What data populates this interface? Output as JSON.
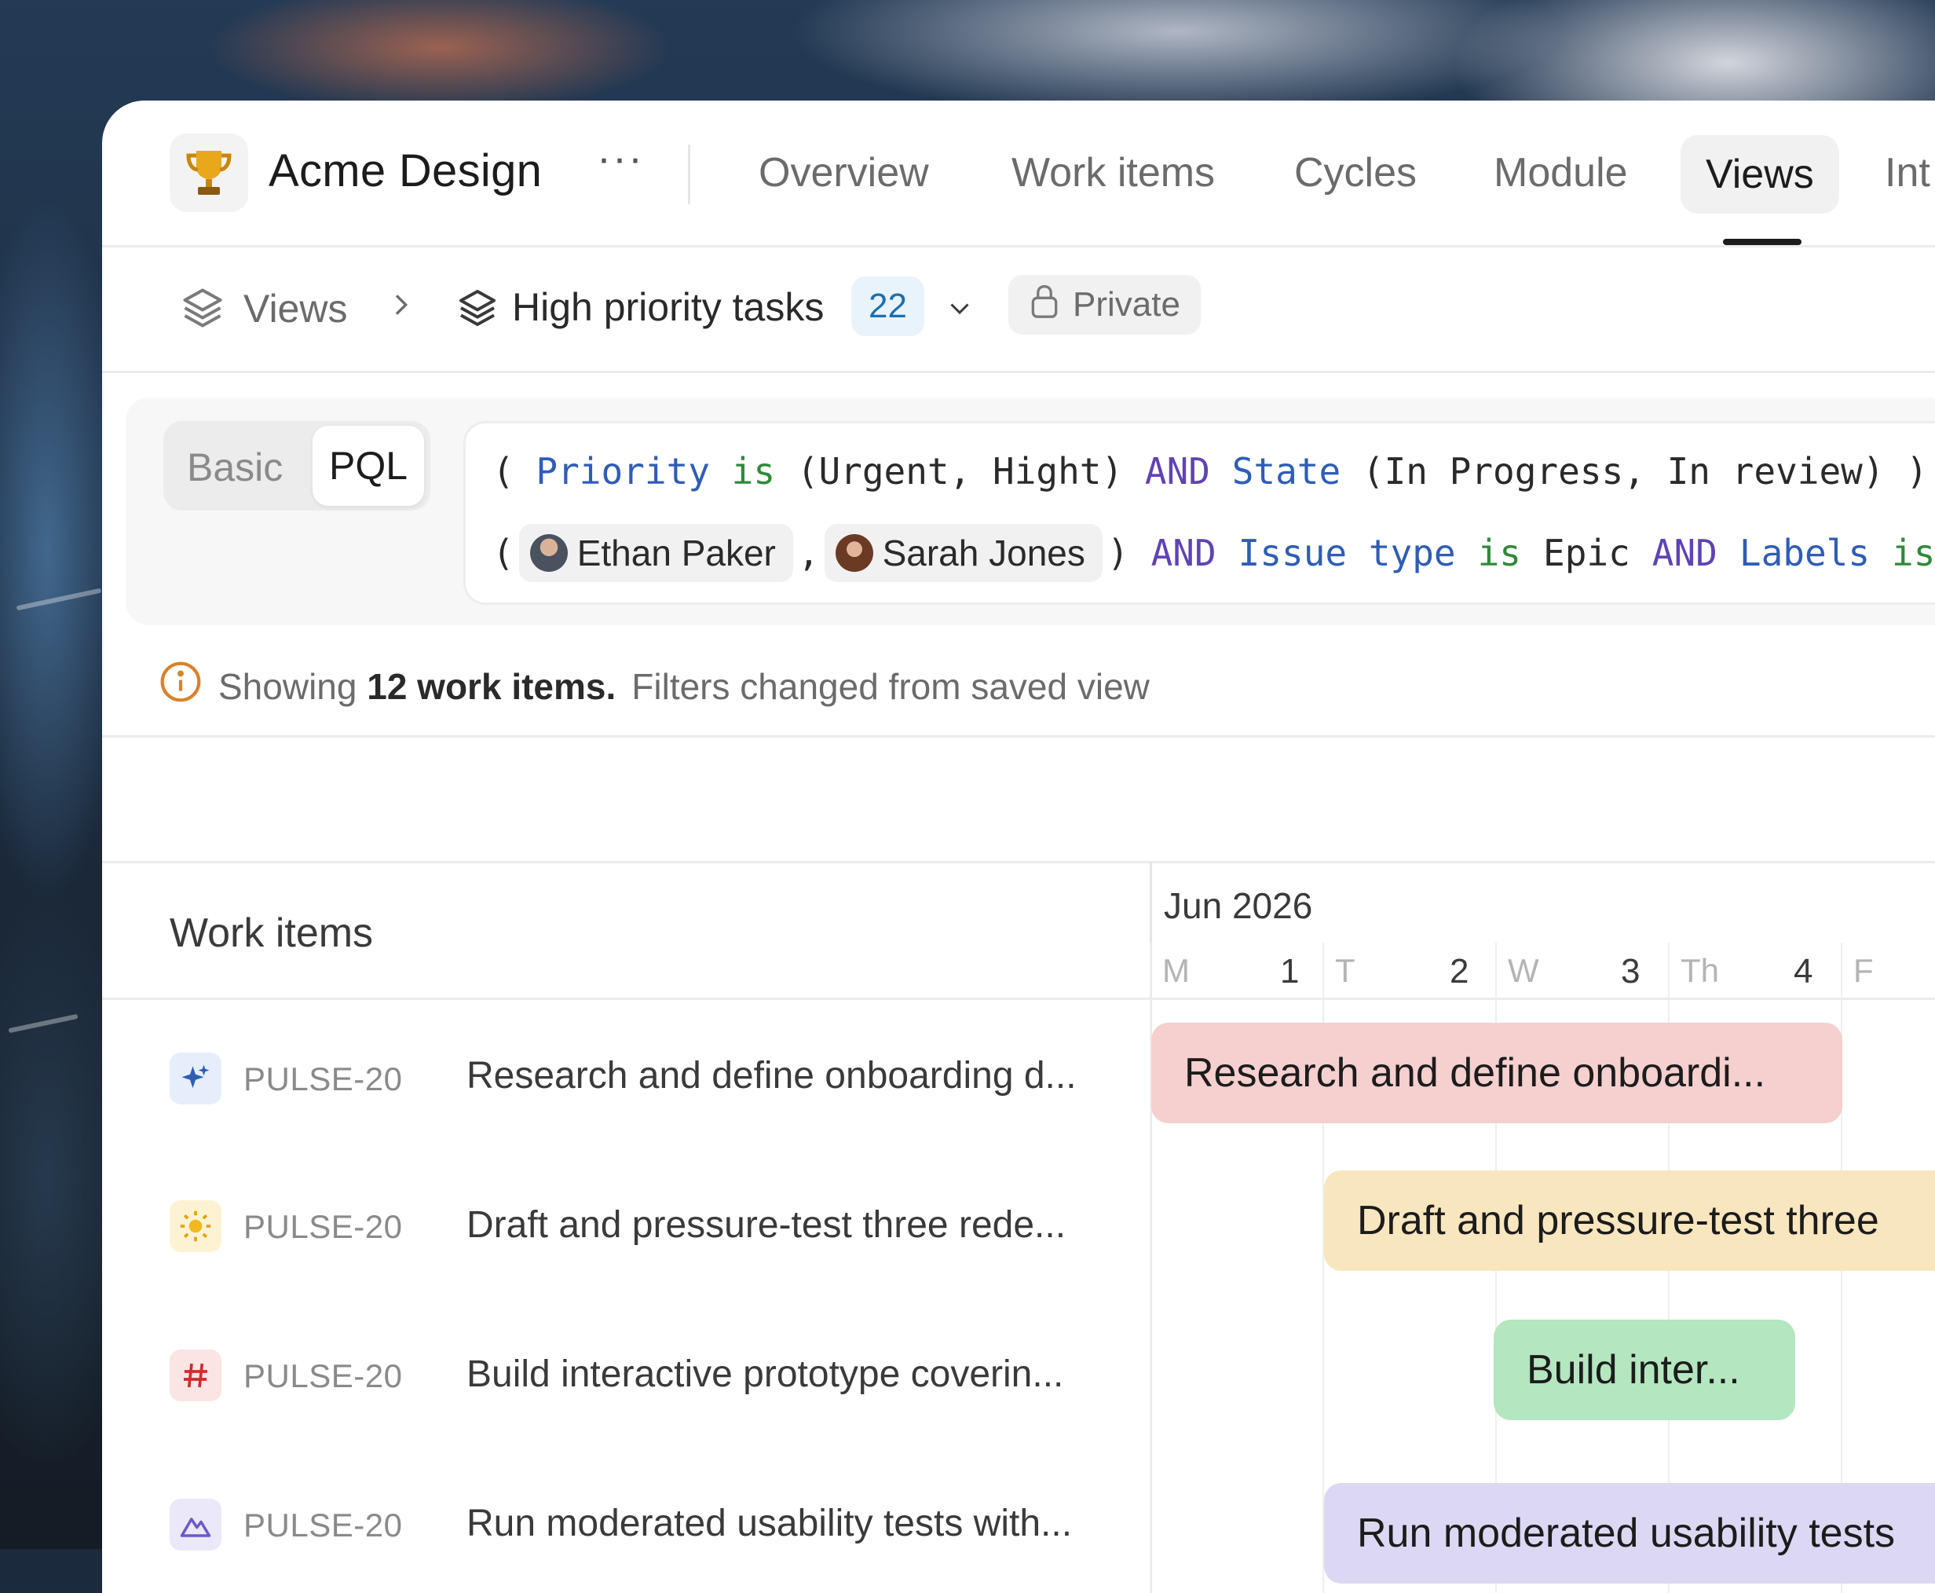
{
  "project": {
    "name": "Acme Design",
    "more": "···"
  },
  "tabs": [
    "Overview",
    "Work items",
    "Cycles",
    "Module",
    "Views",
    "Int"
  ],
  "breadcrumb": {
    "root": "Views",
    "view_name": "High priority tasks",
    "count": "22",
    "visibility": "Private"
  },
  "filter": {
    "modes": [
      "Basic",
      "PQL"
    ],
    "active_mode": "PQL",
    "line1": {
      "open": "(",
      "field1": "Priority",
      "op1": "is",
      "val1": "(Urgent, Hight)",
      "and1": "AND",
      "field2": "State",
      "val2": "(In Progress, In review)",
      "close": ")"
    },
    "line2": {
      "open": "(",
      "person1": "Ethan Paker",
      "comma": ",",
      "person2": "Sarah Jones",
      "close": ")",
      "and1": "AND",
      "field1": "Issue type",
      "op1": "is",
      "val1": "Epic",
      "and2": "AND",
      "field2": "Labels",
      "op2": "is"
    }
  },
  "info": {
    "prefix": "Showing",
    "count_text": "12 work items.",
    "suffix": "Filters changed from saved view"
  },
  "list": {
    "header": "Work items",
    "rows": [
      {
        "id": "PULSE-20",
        "title": "Research and define onboarding d..."
      },
      {
        "id": "PULSE-20",
        "title": "Draft and pressure-test three rede..."
      },
      {
        "id": "PULSE-20",
        "title": "Build interactive prototype coverin..."
      },
      {
        "id": "PULSE-20",
        "title": "Run moderated usability tests with..."
      }
    ]
  },
  "gantt": {
    "month": "Jun 2026",
    "days": [
      {
        "dow": "M",
        "num": "1"
      },
      {
        "dow": "T",
        "num": "2"
      },
      {
        "dow": "W",
        "num": "3"
      },
      {
        "dow": "Th",
        "num": "4"
      },
      {
        "dow": "F",
        "num": ""
      }
    ],
    "bars": [
      {
        "label": "Research and define onboardi...",
        "color": "#f6cfcf"
      },
      {
        "label": "Draft and pressure-test three",
        "color": "#f8e6bf"
      },
      {
        "label": "Build inter...",
        "color": "#b4e6bf"
      },
      {
        "label": "Run moderated usability tests",
        "color": "#dcd8f3"
      }
    ]
  },
  "colors": {
    "accent_blue": "#2f5db6",
    "keyword_green": "#2f8a3a",
    "keyword_purple": "#5f43b5",
    "info_orange": "#d9822b"
  }
}
